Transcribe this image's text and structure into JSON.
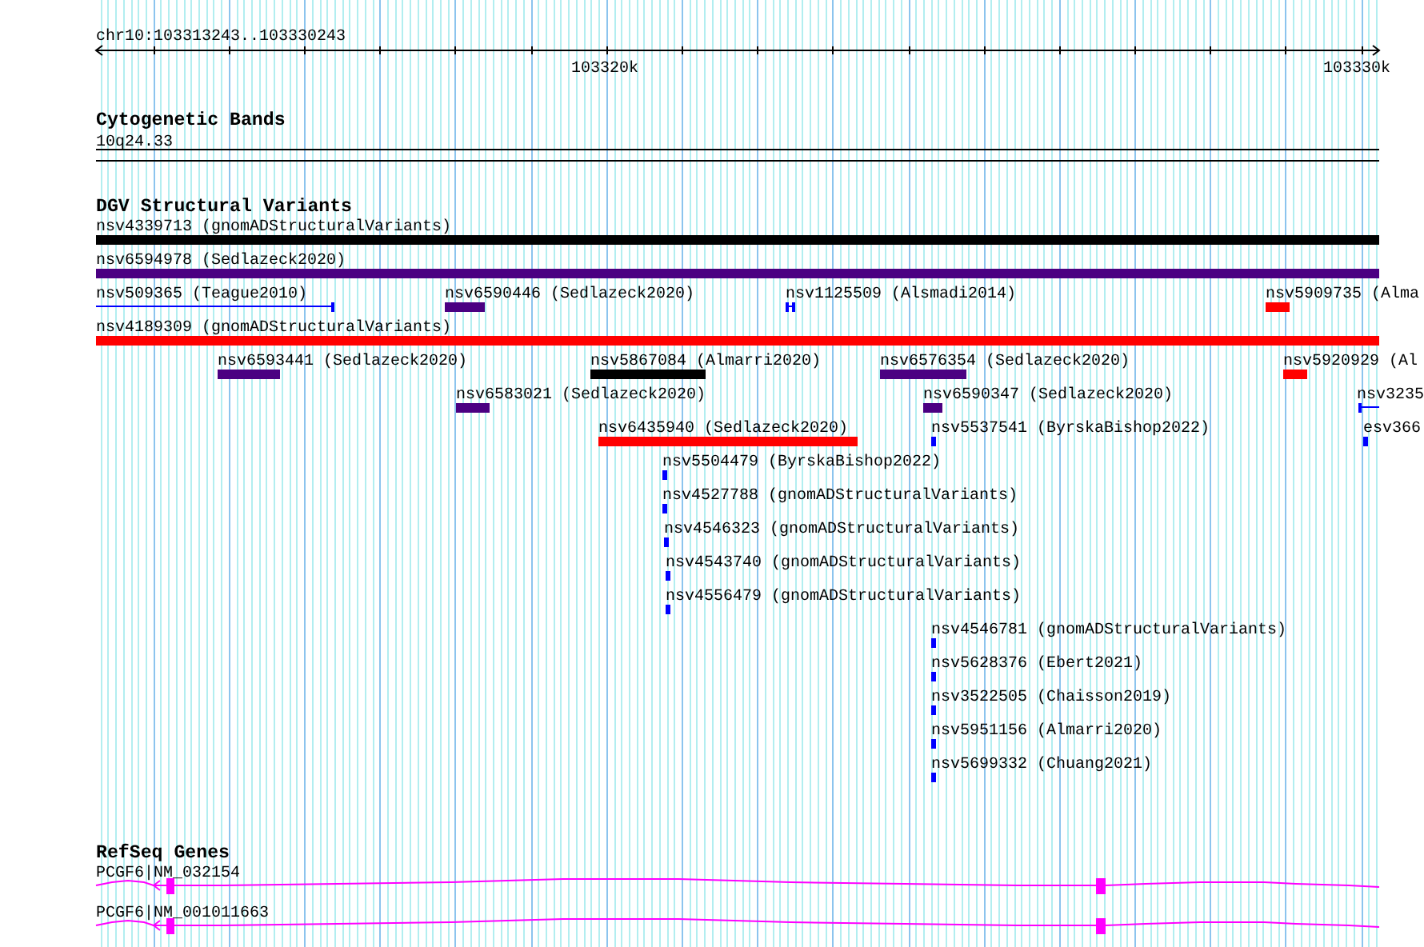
{
  "ruler": {
    "location": "chr10:103313243..103330243",
    "tick_labels": [
      "103320k",
      "103330k"
    ]
  },
  "tracks": [
    {
      "kind": "bands",
      "title": "Cytogenetic Bands",
      "bands": [
        {
          "name": "10q24.33"
        }
      ]
    },
    {
      "kind": "variants",
      "title": "DGV Structural Variants",
      "features": [
        {
          "label": "nsv4339713 (gnomADStructuralVariants)",
          "kind": "bar",
          "color": "#000000"
        },
        {
          "label": "nsv6594978 (Sedlazeck2020)",
          "kind": "bar",
          "color": "#4b0082"
        },
        {
          "label": "nsv509365 (Teague2010)",
          "kind": "line",
          "color": "#0000ff"
        },
        {
          "label": "nsv6590446 (Sedlazeck2020)",
          "kind": "bar",
          "color": "#4b0082"
        },
        {
          "label": "nsv1125509 (Alsmadi2014)",
          "kind": "line",
          "color": "#0000ff"
        },
        {
          "label": "nsv5909735 (Alma",
          "kind": "bar",
          "color": "#ff0000"
        },
        {
          "label": "nsv4189309 (gnomADStructuralVariants)",
          "kind": "bar",
          "color": "#ff0000"
        },
        {
          "label": "nsv6593441 (Sedlazeck2020)",
          "kind": "bar",
          "color": "#4b0082"
        },
        {
          "label": "nsv5867084 (Almarri2020)",
          "kind": "bar",
          "color": "#000000"
        },
        {
          "label": "nsv6576354 (Sedlazeck2020)",
          "kind": "bar",
          "color": "#4b0082"
        },
        {
          "label": "nsv5920929 (Al",
          "kind": "bar",
          "color": "#ff0000"
        },
        {
          "label": "nsv6583021 (Sedlazeck2020)",
          "kind": "bar",
          "color": "#4b0082"
        },
        {
          "label": "nsv6590347 (Sedlazeck2020)",
          "kind": "bar",
          "color": "#4b0082"
        },
        {
          "label": "nsv3235",
          "kind": "line",
          "color": "#0000ff"
        },
        {
          "label": "nsv6435940 (Sedlazeck2020)",
          "kind": "bar",
          "color": "#ff0000"
        },
        {
          "label": "nsv5537541 (ByrskaBishop2022)",
          "kind": "bar",
          "color": "#0000ff"
        },
        {
          "label": "esv366",
          "kind": "bar",
          "color": "#0000ff"
        },
        {
          "label": "nsv5504479 (ByrskaBishop2022)",
          "kind": "bar",
          "color": "#0000ff"
        },
        {
          "label": "nsv4527788 (gnomADStructuralVariants)",
          "kind": "bar",
          "color": "#0000ff"
        },
        {
          "label": "nsv4546323 (gnomADStructuralVariants)",
          "kind": "bar",
          "color": "#0000ff"
        },
        {
          "label": "nsv4543740 (gnomADStructuralVariants)",
          "kind": "bar",
          "color": "#0000ff"
        },
        {
          "label": "nsv4556479 (gnomADStructuralVariants)",
          "kind": "bar",
          "color": "#0000ff"
        },
        {
          "label": "nsv4546781 (gnomADStructuralVariants)",
          "kind": "bar",
          "color": "#0000ff"
        },
        {
          "label": "nsv5628376 (Ebert2021)",
          "kind": "bar",
          "color": "#0000ff"
        },
        {
          "label": "nsv3522505 (Chaisson2019)",
          "kind": "bar",
          "color": "#0000ff"
        },
        {
          "label": "nsv5951156 (Almarri2020)",
          "kind": "bar",
          "color": "#0000ff"
        },
        {
          "label": "nsv5699332 (Chuang2021)",
          "kind": "bar",
          "color": "#0000ff"
        }
      ]
    },
    {
      "kind": "genes",
      "title": "RefSeq Genes",
      "transcripts": [
        {
          "name": "PCGF6|NM_032154",
          "reverse": true
        },
        {
          "name": "PCGF6|NM_001011663",
          "reverse": true
        }
      ]
    }
  ]
}
